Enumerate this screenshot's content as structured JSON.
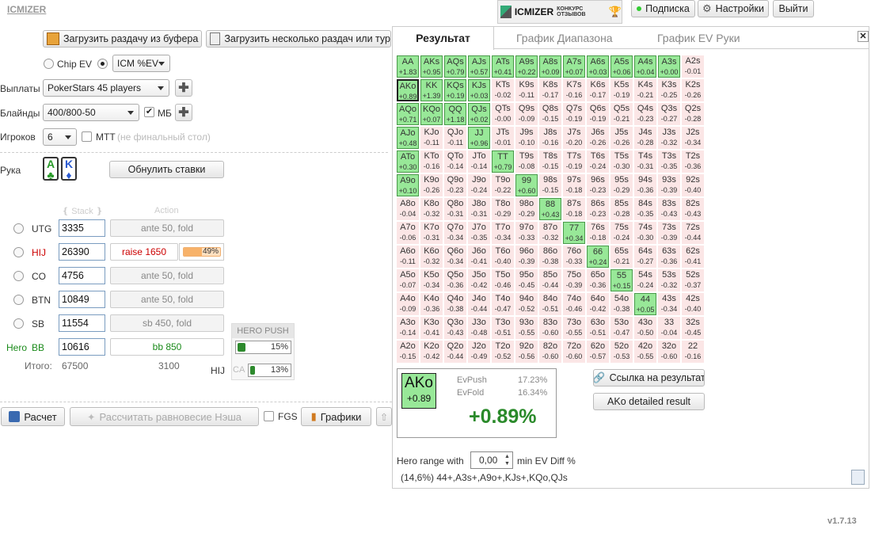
{
  "app": {
    "logo": "ICMIZER",
    "version": "v1.7.13"
  },
  "header": {
    "banner_text": "ICMIZER",
    "banner_sub": "КОНКУРС ОТЗЫВОВ",
    "subscription": "Подписка",
    "settings": "Настройки",
    "logout": "Выйти"
  },
  "toolbar": {
    "load_hand": "Загрузить раздачу из буфера",
    "load_many": "Загрузить несколько раздач или тур"
  },
  "mode": {
    "chip_ev": "Chip EV",
    "icm_ev": "ICM %EV"
  },
  "form": {
    "payouts_label": "Выплаты",
    "payouts_value": "PokerStars 45 players",
    "blinds_label": "Блайнды",
    "blinds_value": "400/800-50",
    "bb_label": "МБ",
    "players_label": "Игроков",
    "players_value": "6",
    "mtt_label": "МТТ",
    "mtt_note": "(не финальный стол)",
    "hand_label": "Рука",
    "card1": "A",
    "card2": "K",
    "reset": "Обнулить ставки"
  },
  "table": {
    "stack_header": "Stack",
    "action_header": "Action",
    "total_label": "Итого:",
    "total_stack": "67500",
    "total_action": "3100",
    "players": [
      {
        "pos": "UTG",
        "stack": "3335",
        "action": "ante 50, fold"
      },
      {
        "pos": "HIJ",
        "stack": "26390",
        "action": "raise 1650",
        "pct": "49%",
        "pct_value": 49
      },
      {
        "pos": "CO",
        "stack": "4756",
        "action": "ante 50, fold"
      },
      {
        "pos": "BTN",
        "stack": "10849",
        "action": "ante 50, fold"
      },
      {
        "pos": "SB",
        "stack": "11554",
        "action": "sb 450, fold"
      },
      {
        "pos": "BB",
        "hero": "Hero",
        "stack": "10616",
        "action": "bb 850"
      }
    ]
  },
  "hero_push": {
    "title": "HERO PUSH",
    "pct": "15%",
    "pct_value": 15,
    "hij_label": "HIJ",
    "ca_label": "CA",
    "ca_pct": "13%",
    "ca_value": 13
  },
  "bottom": {
    "calc": "Расчет",
    "nash": "Рассчитать равновесие Нэша",
    "fgs": "FGS",
    "charts": "Графики"
  },
  "result": {
    "tabs": [
      "Результат",
      "График Диапазона",
      "График EV Руки"
    ],
    "hand": "AKo",
    "hand_ev": "+0.89",
    "evpush_label": "EvPush",
    "evpush": "17.23%",
    "evfold_label": "EvFold",
    "evfold": "16.34%",
    "big_ev": "+0.89%",
    "link": "Ссылка на результат",
    "detailed": "AKo detailed result",
    "range_label": "Hero range with",
    "range_value": "0,00",
    "range_suffix": "min EV Diff %",
    "range_text": "(14,6%) 44+,A3s+,A9o+,KJs+,KQo,QJs",
    "grid": [
      [
        [
          "AA",
          "+1.83",
          1
        ],
        [
          "AKs",
          "+0.95",
          1
        ],
        [
          "AQs",
          "+0.79",
          1
        ],
        [
          "AJs",
          "+0.57",
          1
        ],
        [
          "ATs",
          "+0.41",
          1
        ],
        [
          "A9s",
          "+0.22",
          1
        ],
        [
          "A8s",
          "+0.09",
          1
        ],
        [
          "A7s",
          "+0.07",
          1
        ],
        [
          "A6s",
          "+0.03",
          1
        ],
        [
          "A5s",
          "+0.06",
          1
        ],
        [
          "A4s",
          "+0.04",
          1
        ],
        [
          "A3s",
          "+0.00",
          1
        ],
        [
          "A2s",
          "-0.01",
          0
        ]
      ],
      [
        [
          "AKo",
          "+0.89",
          2
        ],
        [
          "KK",
          "+1.39",
          1
        ],
        [
          "KQs",
          "+0.19",
          1
        ],
        [
          "KJs",
          "+0.03",
          1
        ],
        [
          "KTs",
          "-0.02",
          0
        ],
        [
          "K9s",
          "-0.11",
          0
        ],
        [
          "K8s",
          "-0.17",
          0
        ],
        [
          "K7s",
          "-0.16",
          0
        ],
        [
          "K6s",
          "-0.17",
          0
        ],
        [
          "K5s",
          "-0.19",
          0
        ],
        [
          "K4s",
          "-0.21",
          0
        ],
        [
          "K3s",
          "-0.25",
          0
        ],
        [
          "K2s",
          "-0.26",
          0
        ]
      ],
      [
        [
          "AQo",
          "+0.71",
          1
        ],
        [
          "KQo",
          "+0.07",
          1
        ],
        [
          "QQ",
          "+1.18",
          1
        ],
        [
          "QJs",
          "+0.02",
          1
        ],
        [
          "QTs",
          "-0.00",
          0
        ],
        [
          "Q9s",
          "-0.09",
          0
        ],
        [
          "Q8s",
          "-0.15",
          0
        ],
        [
          "Q7s",
          "-0.19",
          0
        ],
        [
          "Q6s",
          "-0.19",
          0
        ],
        [
          "Q5s",
          "-0.21",
          0
        ],
        [
          "Q4s",
          "-0.23",
          0
        ],
        [
          "Q3s",
          "-0.27",
          0
        ],
        [
          "Q2s",
          "-0.28",
          0
        ]
      ],
      [
        [
          "AJo",
          "+0.48",
          1
        ],
        [
          "KJo",
          "-0.11",
          0
        ],
        [
          "QJo",
          "-0.11",
          0
        ],
        [
          "JJ",
          "+0.96",
          1
        ],
        [
          "JTs",
          "-0.01",
          0
        ],
        [
          "J9s",
          "-0.10",
          0
        ],
        [
          "J8s",
          "-0.16",
          0
        ],
        [
          "J7s",
          "-0.20",
          0
        ],
        [
          "J6s",
          "-0.26",
          0
        ],
        [
          "J5s",
          "-0.26",
          0
        ],
        [
          "J4s",
          "-0.28",
          0
        ],
        [
          "J3s",
          "-0.32",
          0
        ],
        [
          "J2s",
          "-0.34",
          0
        ]
      ],
      [
        [
          "ATo",
          "+0.30",
          1
        ],
        [
          "KTo",
          "-0.16",
          0
        ],
        [
          "QTo",
          "-0.14",
          0
        ],
        [
          "JTo",
          "-0.14",
          0
        ],
        [
          "TT",
          "+0.79",
          1
        ],
        [
          "T9s",
          "-0.08",
          0
        ],
        [
          "T8s",
          "-0.15",
          0
        ],
        [
          "T7s",
          "-0.19",
          0
        ],
        [
          "T6s",
          "-0.24",
          0
        ],
        [
          "T5s",
          "-0.30",
          0
        ],
        [
          "T4s",
          "-0.31",
          0
        ],
        [
          "T3s",
          "-0.35",
          0
        ],
        [
          "T2s",
          "-0.36",
          0
        ]
      ],
      [
        [
          "A9o",
          "+0.10",
          1
        ],
        [
          "K9o",
          "-0.26",
          0
        ],
        [
          "Q9o",
          "-0.23",
          0
        ],
        [
          "J9o",
          "-0.24",
          0
        ],
        [
          "T9o",
          "-0.22",
          0
        ],
        [
          "99",
          "+0.60",
          1
        ],
        [
          "98s",
          "-0.15",
          0
        ],
        [
          "97s",
          "-0.18",
          0
        ],
        [
          "96s",
          "-0.23",
          0
        ],
        [
          "95s",
          "-0.29",
          0
        ],
        [
          "94s",
          "-0.36",
          0
        ],
        [
          "93s",
          "-0.39",
          0
        ],
        [
          "92s",
          "-0.40",
          0
        ]
      ],
      [
        [
          "A8o",
          "-0.04",
          0
        ],
        [
          "K8o",
          "-0.32",
          0
        ],
        [
          "Q8o",
          "-0.31",
          0
        ],
        [
          "J8o",
          "-0.31",
          0
        ],
        [
          "T8o",
          "-0.29",
          0
        ],
        [
          "98o",
          "-0.29",
          0
        ],
        [
          "88",
          "+0.43",
          1
        ],
        [
          "87s",
          "-0.18",
          0
        ],
        [
          "86s",
          "-0.23",
          0
        ],
        [
          "85s",
          "-0.28",
          0
        ],
        [
          "84s",
          "-0.35",
          0
        ],
        [
          "83s",
          "-0.43",
          0
        ],
        [
          "82s",
          "-0.43",
          0
        ]
      ],
      [
        [
          "A7o",
          "-0.06",
          0
        ],
        [
          "K7o",
          "-0.31",
          0
        ],
        [
          "Q7o",
          "-0.34",
          0
        ],
        [
          "J7o",
          "-0.35",
          0
        ],
        [
          "T7o",
          "-0.34",
          0
        ],
        [
          "97o",
          "-0.33",
          0
        ],
        [
          "87o",
          "-0.32",
          0
        ],
        [
          "77",
          "+0.34",
          1
        ],
        [
          "76s",
          "-0.18",
          0
        ],
        [
          "75s",
          "-0.24",
          0
        ],
        [
          "74s",
          "-0.30",
          0
        ],
        [
          "73s",
          "-0.39",
          0
        ],
        [
          "72s",
          "-0.44",
          0
        ]
      ],
      [
        [
          "A6o",
          "-0.11",
          0
        ],
        [
          "K6o",
          "-0.32",
          0
        ],
        [
          "Q6o",
          "-0.34",
          0
        ],
        [
          "J6o",
          "-0.41",
          0
        ],
        [
          "T6o",
          "-0.40",
          0
        ],
        [
          "96o",
          "-0.39",
          0
        ],
        [
          "86o",
          "-0.38",
          0
        ],
        [
          "76o",
          "-0.33",
          0
        ],
        [
          "66",
          "+0.24",
          1
        ],
        [
          "65s",
          "-0.21",
          0
        ],
        [
          "64s",
          "-0.27",
          0
        ],
        [
          "63s",
          "-0.36",
          0
        ],
        [
          "62s",
          "-0.41",
          0
        ]
      ],
      [
        [
          "A5o",
          "-0.07",
          0
        ],
        [
          "K5o",
          "-0.34",
          0
        ],
        [
          "Q5o",
          "-0.36",
          0
        ],
        [
          "J5o",
          "-0.42",
          0
        ],
        [
          "T5o",
          "-0.46",
          0
        ],
        [
          "95o",
          "-0.45",
          0
        ],
        [
          "85o",
          "-0.44",
          0
        ],
        [
          "75o",
          "-0.39",
          0
        ],
        [
          "65o",
          "-0.36",
          0
        ],
        [
          "55",
          "+0.15",
          1
        ],
        [
          "54s",
          "-0.24",
          0
        ],
        [
          "53s",
          "-0.32",
          0
        ],
        [
          "52s",
          "-0.37",
          0
        ]
      ],
      [
        [
          "A4o",
          "-0.09",
          0
        ],
        [
          "K4o",
          "-0.36",
          0
        ],
        [
          "Q4o",
          "-0.38",
          0
        ],
        [
          "J4o",
          "-0.44",
          0
        ],
        [
          "T4o",
          "-0.47",
          0
        ],
        [
          "94o",
          "-0.52",
          0
        ],
        [
          "84o",
          "-0.51",
          0
        ],
        [
          "74o",
          "-0.46",
          0
        ],
        [
          "64o",
          "-0.42",
          0
        ],
        [
          "54o",
          "-0.38",
          0
        ],
        [
          "44",
          "+0.05",
          1
        ],
        [
          "43s",
          "-0.34",
          0
        ],
        [
          "42s",
          "-0.40",
          0
        ]
      ],
      [
        [
          "A3o",
          "-0.14",
          0
        ],
        [
          "K3o",
          "-0.41",
          0
        ],
        [
          "Q3o",
          "-0.43",
          0
        ],
        [
          "J3o",
          "-0.48",
          0
        ],
        [
          "T3o",
          "-0.51",
          0
        ],
        [
          "93o",
          "-0.55",
          0
        ],
        [
          "83o",
          "-0.60",
          0
        ],
        [
          "73o",
          "-0.55",
          0
        ],
        [
          "63o",
          "-0.51",
          0
        ],
        [
          "53o",
          "-0.47",
          0
        ],
        [
          "43o",
          "-0.50",
          0
        ],
        [
          "33",
          "-0.04",
          0
        ],
        [
          "32s",
          "-0.45",
          0
        ]
      ],
      [
        [
          "A2o",
          "-0.15",
          0
        ],
        [
          "K2o",
          "-0.42",
          0
        ],
        [
          "Q2o",
          "-0.44",
          0
        ],
        [
          "J2o",
          "-0.49",
          0
        ],
        [
          "T2o",
          "-0.52",
          0
        ],
        [
          "92o",
          "-0.56",
          0
        ],
        [
          "82o",
          "-0.60",
          0
        ],
        [
          "72o",
          "-0.60",
          0
        ],
        [
          "62o",
          "-0.57",
          0
        ],
        [
          "52o",
          "-0.53",
          0
        ],
        [
          "42o",
          "-0.55",
          0
        ],
        [
          "32o",
          "-0.60",
          0
        ],
        [
          "22",
          "-0.16",
          0
        ]
      ]
    ]
  }
}
